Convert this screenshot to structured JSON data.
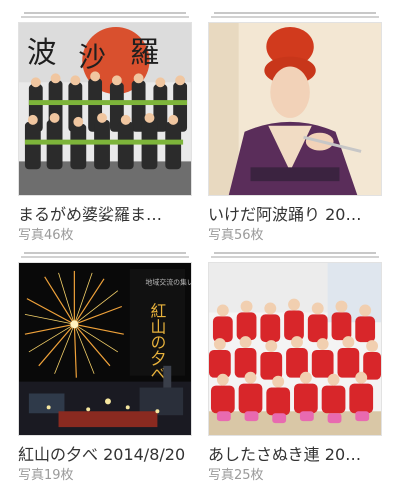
{
  "albums": [
    {
      "title": "まるがめ婆娑羅ま…",
      "count": "写真46枚",
      "thumb_icon": "dance-team-photo-icon"
    },
    {
      "title": "いけだ阿波踊り 20…",
      "count": "写真56枚",
      "thumb_icon": "kimono-portrait-photo-icon"
    },
    {
      "title": "紅山の夕べ 2014/8/20",
      "count": "写真19枚",
      "thumb_icon": "fireworks-poster-icon",
      "poster_text": "紅山の夕べ"
    },
    {
      "title": "あしたさぬき連 20…",
      "count": "写真25枚",
      "thumb_icon": "group-red-shirts-photo-icon"
    }
  ],
  "colors": {
    "title_text": "#333333",
    "count_text": "#9a9a9a",
    "stack_line": "#c8c8c8"
  }
}
